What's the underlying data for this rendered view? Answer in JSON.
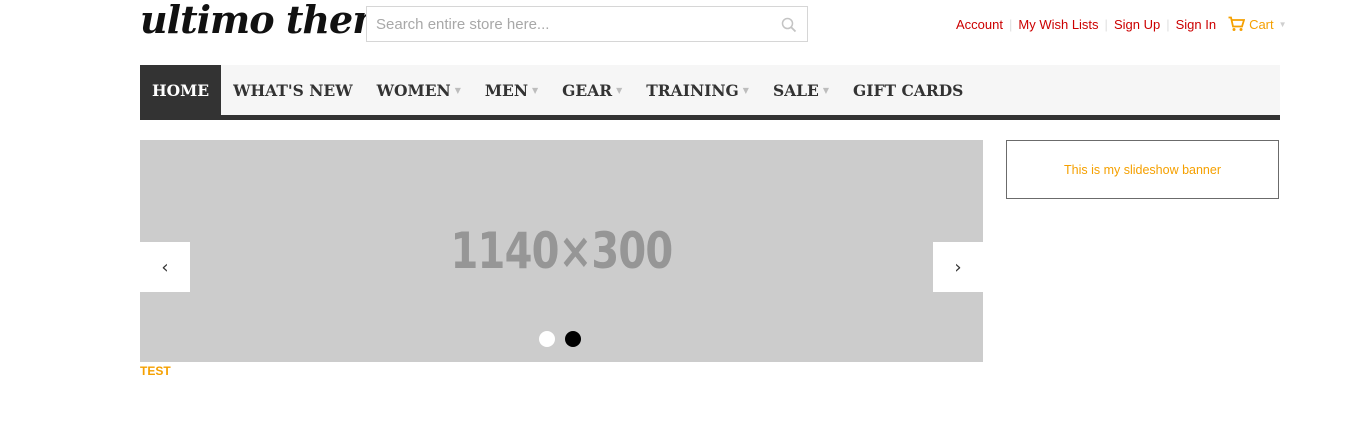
{
  "header": {
    "logo_text": "ultimo theme",
    "search": {
      "placeholder": "Search entire store here..."
    },
    "links": {
      "account": "Account",
      "wishlist": "My Wish Lists",
      "signup": "Sign Up",
      "signin": "Sign In",
      "cart": "Cart"
    }
  },
  "nav": {
    "items": [
      {
        "label": "HOME"
      },
      {
        "label": "WHAT'S NEW"
      },
      {
        "label": "WOMEN"
      },
      {
        "label": "MEN"
      },
      {
        "label": "GEAR"
      },
      {
        "label": "TRAINING"
      },
      {
        "label": "SALE"
      },
      {
        "label": "GIFT CARDS"
      }
    ]
  },
  "slideshow": {
    "image_text": "1140×300",
    "prev": "‹",
    "next": "›",
    "caption": "TEST"
  },
  "banner": {
    "text": "This is my slideshow banner"
  },
  "colors": {
    "link_red": "#cc0000",
    "accent_orange": "#f5a000",
    "nav_active": "#333333",
    "slide_bg": "#cccccc"
  }
}
